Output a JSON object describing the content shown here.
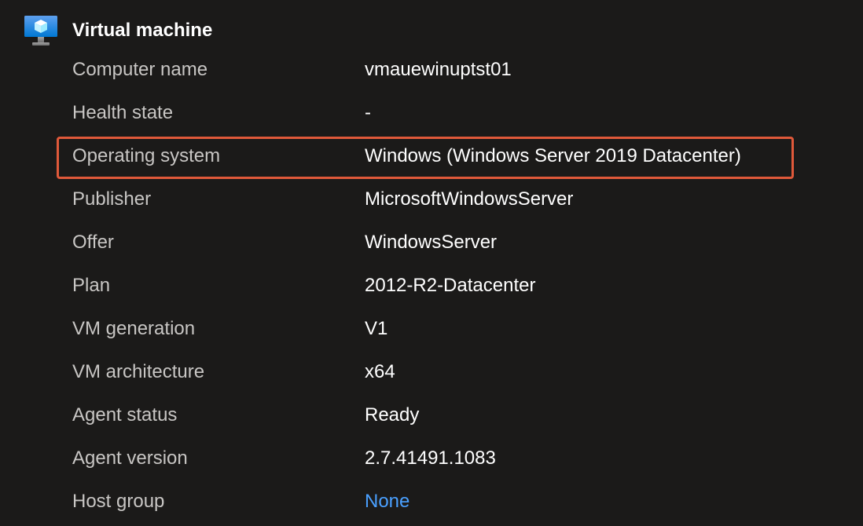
{
  "section": {
    "title": "Virtual machine",
    "icon": "virtual-machine-icon"
  },
  "properties": [
    {
      "label": "Computer name",
      "value": "vmauewinuptst01"
    },
    {
      "label": "Health state",
      "value": "-"
    },
    {
      "label": "Operating system",
      "value": "Windows (Windows Server 2019 Datacenter)"
    },
    {
      "label": "Publisher",
      "value": "MicrosoftWindowsServer"
    },
    {
      "label": "Offer",
      "value": "WindowsServer"
    },
    {
      "label": "Plan",
      "value": "2012-R2-Datacenter"
    },
    {
      "label": "VM generation",
      "value": "V1"
    },
    {
      "label": "VM architecture",
      "value": "x64"
    },
    {
      "label": "Agent status",
      "value": "Ready"
    },
    {
      "label": "Agent version",
      "value": "2.7.41491.1083"
    },
    {
      "label": "Host group",
      "value": "None"
    }
  ],
  "highlight": {
    "row": "Operating system",
    "color": "#e0593a"
  },
  "colors": {
    "background": "#1b1a19",
    "label": "#c8c6c4",
    "value": "#ffffff",
    "link": "#4aa0ff"
  }
}
